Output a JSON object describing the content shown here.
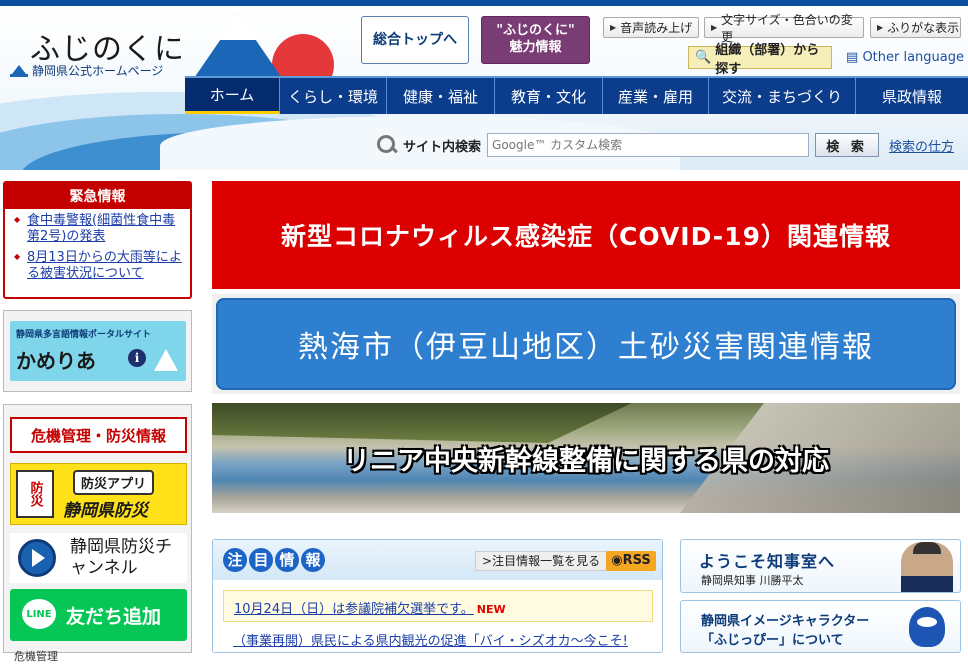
{
  "colors": {
    "brand_blue": "#0b3d8c",
    "emergency_red": "#c40000",
    "covid_red": "#dc0000",
    "atami_blue": "#2e7fd0",
    "line_green": "#06c755",
    "rss_orange": "#f5a623",
    "charm_purple": "#7a3c74"
  },
  "header": {
    "logo_main": "ふじのくに",
    "logo_sub": "静岡県公式ホームページ",
    "top_button": "総合トップへ",
    "charm_line1": "\"ふじのくに\"",
    "charm_line2": "魅力情報",
    "utilities": {
      "voice": "音声読み上げ",
      "font": "文字サイズ・色合いの変更",
      "furigana": "ふりがな表示"
    },
    "org_search": "組織（部署）から探す",
    "other_language": "Other language",
    "nav": [
      "ホーム",
      "くらし・環境",
      "健康・福祉",
      "教育・文化",
      "産業・雇用",
      "交流・まちづくり",
      "県政情報"
    ],
    "search": {
      "label": "サイト内検索",
      "placeholder": "Google™ カスタム検索",
      "button": "検 索",
      "help": "検索の仕方"
    }
  },
  "sidebar": {
    "emergency": {
      "title": "緊急情報",
      "items": [
        "食中毒警報(細菌性食中毒第2号)の発表",
        "8月13日からの大雨等による被害状況について"
      ]
    },
    "kameria": {
      "subtitle": "静岡県多言語情報ポータルサイト",
      "name": "かめりあ",
      "badge": "i"
    },
    "bousai": {
      "title": "危機管理・防災情報",
      "app_badge": "防災",
      "app_top": "防災アプリ",
      "app_main": "静岡県防災",
      "channel": "静岡県防災チャンネル",
      "line_icon": "LINE",
      "line": "友だち追加",
      "more": "危機管理"
    }
  },
  "banners": {
    "covid": "新型コロナウィルス感染症（COVID-19）関連情報",
    "atami": "熱海市（伊豆山地区）土砂災害関連情報",
    "linear": "リニア中央新幹線整備に関する県の対応"
  },
  "news": {
    "title_chars": [
      "注",
      "目",
      "情",
      "報"
    ],
    "list_link": "注目情報一覧を見る",
    "rss": "RSS",
    "items": [
      {
        "text": "10月24日（日）は参議院補欠選挙です。",
        "badge": "NEW"
      },
      {
        "text": "（事業再開）県民による県内観光の促進「バイ・シズオカ～今こそ!"
      }
    ]
  },
  "governor": {
    "title": "ようこそ知事室へ",
    "name": "静岡県知事 川勝平太"
  },
  "character": {
    "line1": "静岡県イメージキャラクター",
    "line2": "「ふじっぴー」について"
  }
}
